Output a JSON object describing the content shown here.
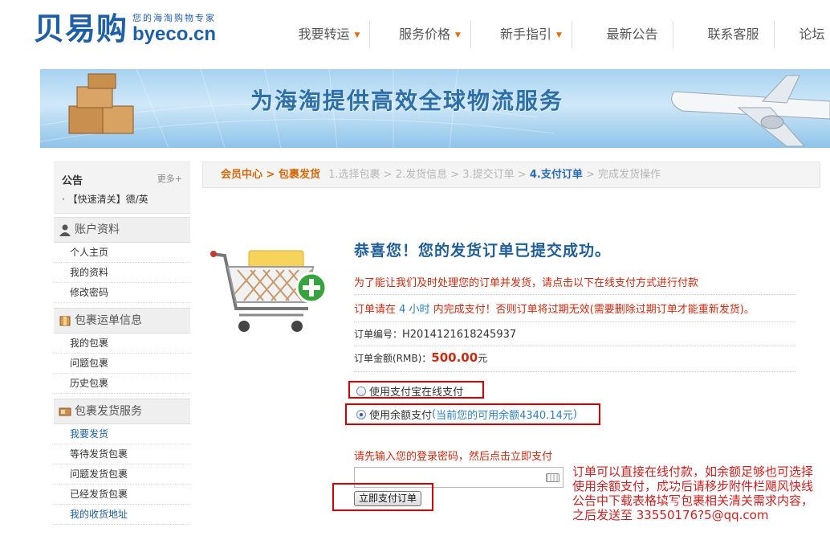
{
  "logo": {
    "cn": "贝易购",
    "slogan": "您的海淘购物专家",
    "en": "byeco.cn"
  },
  "nav": [
    {
      "label": "我要转运",
      "has_arrow": true
    },
    {
      "label": "服务价格",
      "has_arrow": true
    },
    {
      "label": "新手指引",
      "has_arrow": true
    },
    {
      "label": "最新公告",
      "has_arrow": false
    },
    {
      "label": "联系客服",
      "has_arrow": false
    },
    {
      "label": "论坛",
      "has_arrow": false
    }
  ],
  "nav_arrow": "▼",
  "banner": {
    "text": "为海淘提供高效全球物流服务"
  },
  "sidebar": {
    "notice": {
      "title": "公告",
      "more": "更多+",
      "item": "·  【快速清关】德/英"
    },
    "sections": [
      {
        "title": "账户资料",
        "icon": "user-icon",
        "items": [
          {
            "label": "个人主页"
          },
          {
            "label": "我的资料"
          },
          {
            "label": "修改密码"
          }
        ]
      },
      {
        "title": "包裹运单信息",
        "icon": "package-icon",
        "items": [
          {
            "label": "我的包裹"
          },
          {
            "label": "问题包裹"
          },
          {
            "label": "历史包裹"
          }
        ]
      },
      {
        "title": "包裹发货服务",
        "icon": "shipping-icon",
        "items": [
          {
            "label": "我要发货"
          },
          {
            "label": "等待发货包裹"
          },
          {
            "label": "问题发货包裹"
          },
          {
            "label": "已经发货包裹"
          },
          {
            "label": "我的收货地址"
          }
        ]
      }
    ]
  },
  "breadcrumb": {
    "member_center": "会员中心",
    "sep": " > ",
    "package_shipping": "包裹发货",
    "step1": "1.选择包裹",
    "step2": "2.发货信息",
    "step3": "3.提交订单",
    "step4": "4.支付订单",
    "step5": "完成发货操作"
  },
  "main": {
    "success_title": "恭喜您！您的发货订单已提交成功。",
    "prompt": "为了能让我们及时处理您的订单并发货，请点击以下在线支付方式进行付款",
    "deadline_prefix": "订单请在 ",
    "deadline_hours": "4 小时",
    "deadline_suffix": " 内完成支付！否则订单将过期无效(需要删除过期订单才能重新发货)。",
    "order_no_label": "订单编号：",
    "order_no": "H2014121618245937",
    "amount_label": "订单金额(RMB)：",
    "amount": "500.00",
    "amount_unit": "元",
    "pay_alipay": "使用支付宝在线支付",
    "pay_balance": "使用余额支付",
    "balance_note_open": "(",
    "balance_note": "当前您的可用余额",
    "balance_value": "4340.14元",
    "balance_note_close": ")",
    "password_prompt": "请先输入您的登录密码，然后点击立即支付",
    "password_value": "",
    "pay_button": "立即支付订单"
  },
  "selected_payment": "balance",
  "annotation": {
    "text": "订单可以直接在线付款，如余额足够也可选择使用余额支付，成功后请移步附件栏飓风快线公告中下载表格填写包裹相关清关需求内容，之后发送至 33550176?5@qq.com"
  },
  "colors": {
    "brand_blue": "#1f5fa8",
    "title_blue": "#1f5e96",
    "crumb_orange": "#d56a0c",
    "red_text": "#cc2a0f",
    "highlight_box": "#d40000"
  }
}
